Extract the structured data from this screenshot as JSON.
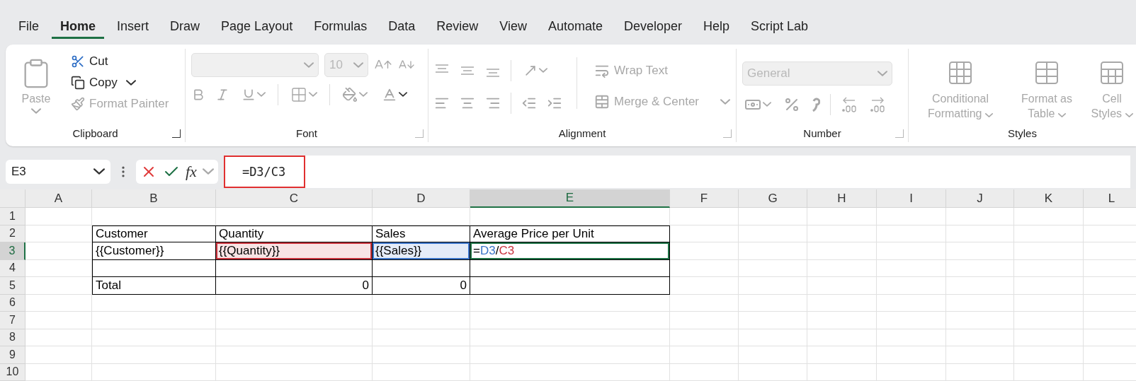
{
  "tabs": [
    {
      "label": "File",
      "selected": false
    },
    {
      "label": "Home",
      "selected": true
    },
    {
      "label": "Insert",
      "selected": false
    },
    {
      "label": "Draw",
      "selected": false
    },
    {
      "label": "Page Layout",
      "selected": false
    },
    {
      "label": "Formulas",
      "selected": false
    },
    {
      "label": "Data",
      "selected": false
    },
    {
      "label": "Review",
      "selected": false
    },
    {
      "label": "View",
      "selected": false
    },
    {
      "label": "Automate",
      "selected": false
    },
    {
      "label": "Developer",
      "selected": false
    },
    {
      "label": "Help",
      "selected": false
    },
    {
      "label": "Script Lab",
      "selected": false
    }
  ],
  "ribbon": {
    "groups": [
      {
        "kind": "clipboard",
        "label": "Clipboard",
        "paste": {
          "label": "Paste",
          "disabled": true
        },
        "cut": {
          "label": "Cut",
          "disabled": false
        },
        "copy": {
          "label": "Copy",
          "disabled": false
        },
        "format_painter": {
          "label": "Format Painter",
          "disabled": true
        }
      },
      {
        "kind": "font",
        "label": "Font",
        "disabled": true,
        "font_size": "10"
      },
      {
        "kind": "alignment",
        "label": "Alignment",
        "disabled": true,
        "wrap_text": "Wrap Text",
        "merge_center": "Merge & Center"
      },
      {
        "kind": "number",
        "label": "Number",
        "disabled": true,
        "format": "General"
      },
      {
        "kind": "styles",
        "label": "Styles",
        "disabled": true,
        "buttons": [
          "Conditional Formatting",
          "Format as Table",
          "Cell Styles"
        ]
      }
    ]
  },
  "formula_bar": {
    "name_box": "E3",
    "fx": "fx",
    "formula": "=D3/C3",
    "highlighted": true
  },
  "sheet": {
    "columns": [
      {
        "label": "A",
        "selected": false
      },
      {
        "label": "B",
        "selected": false
      },
      {
        "label": "C",
        "selected": false
      },
      {
        "label": "D",
        "selected": false
      },
      {
        "label": "E",
        "selected": true
      },
      {
        "label": "F",
        "selected": false
      },
      {
        "label": "G",
        "selected": false
      },
      {
        "label": "H",
        "selected": false
      },
      {
        "label": "I",
        "selected": false
      },
      {
        "label": "J",
        "selected": false
      },
      {
        "label": "K",
        "selected": false
      },
      {
        "label": "L",
        "selected": false
      }
    ],
    "rows": [
      {
        "label": "1",
        "selected": false
      },
      {
        "label": "2",
        "selected": false
      },
      {
        "label": "3",
        "selected": true
      },
      {
        "label": "4",
        "selected": false
      },
      {
        "label": "5",
        "selected": false
      },
      {
        "label": "6",
        "selected": false
      },
      {
        "label": "7",
        "selected": false
      },
      {
        "label": "8",
        "selected": false
      },
      {
        "label": "9",
        "selected": false
      },
      {
        "label": "10",
        "selected": false
      }
    ],
    "table": {
      "rows": [
        [
          {
            "kind": "text",
            "text": "Customer"
          },
          {
            "kind": "text",
            "text": "Quantity"
          },
          {
            "kind": "text",
            "text": "Sales"
          },
          {
            "kind": "text",
            "text": "Average Price per Unit"
          }
        ],
        [
          {
            "kind": "text",
            "text": "{{Customer}}"
          },
          {
            "kind": "text",
            "text": "{{Quantity}}",
            "color": "#c8323c"
          },
          {
            "kind": "text",
            "text": "{{Sales}}",
            "color": "#3b74c8"
          },
          {
            "kind": "formula",
            "active": true,
            "parts": [
              {
                "text": "=",
                "color": "#000000"
              },
              {
                "text": "D3",
                "color": "#3b74c8"
              },
              {
                "text": "/",
                "color": "#000000"
              },
              {
                "text": "C3",
                "color": "#c8323c"
              }
            ]
          }
        ],
        [
          {
            "kind": "empty"
          },
          {
            "kind": "empty"
          },
          {
            "kind": "empty"
          },
          {
            "kind": "empty"
          }
        ],
        [
          {
            "kind": "text",
            "text": "Total"
          },
          {
            "kind": "number",
            "text": "0"
          },
          {
            "kind": "number",
            "text": "0"
          },
          {
            "kind": "empty"
          }
        ]
      ]
    }
  }
}
